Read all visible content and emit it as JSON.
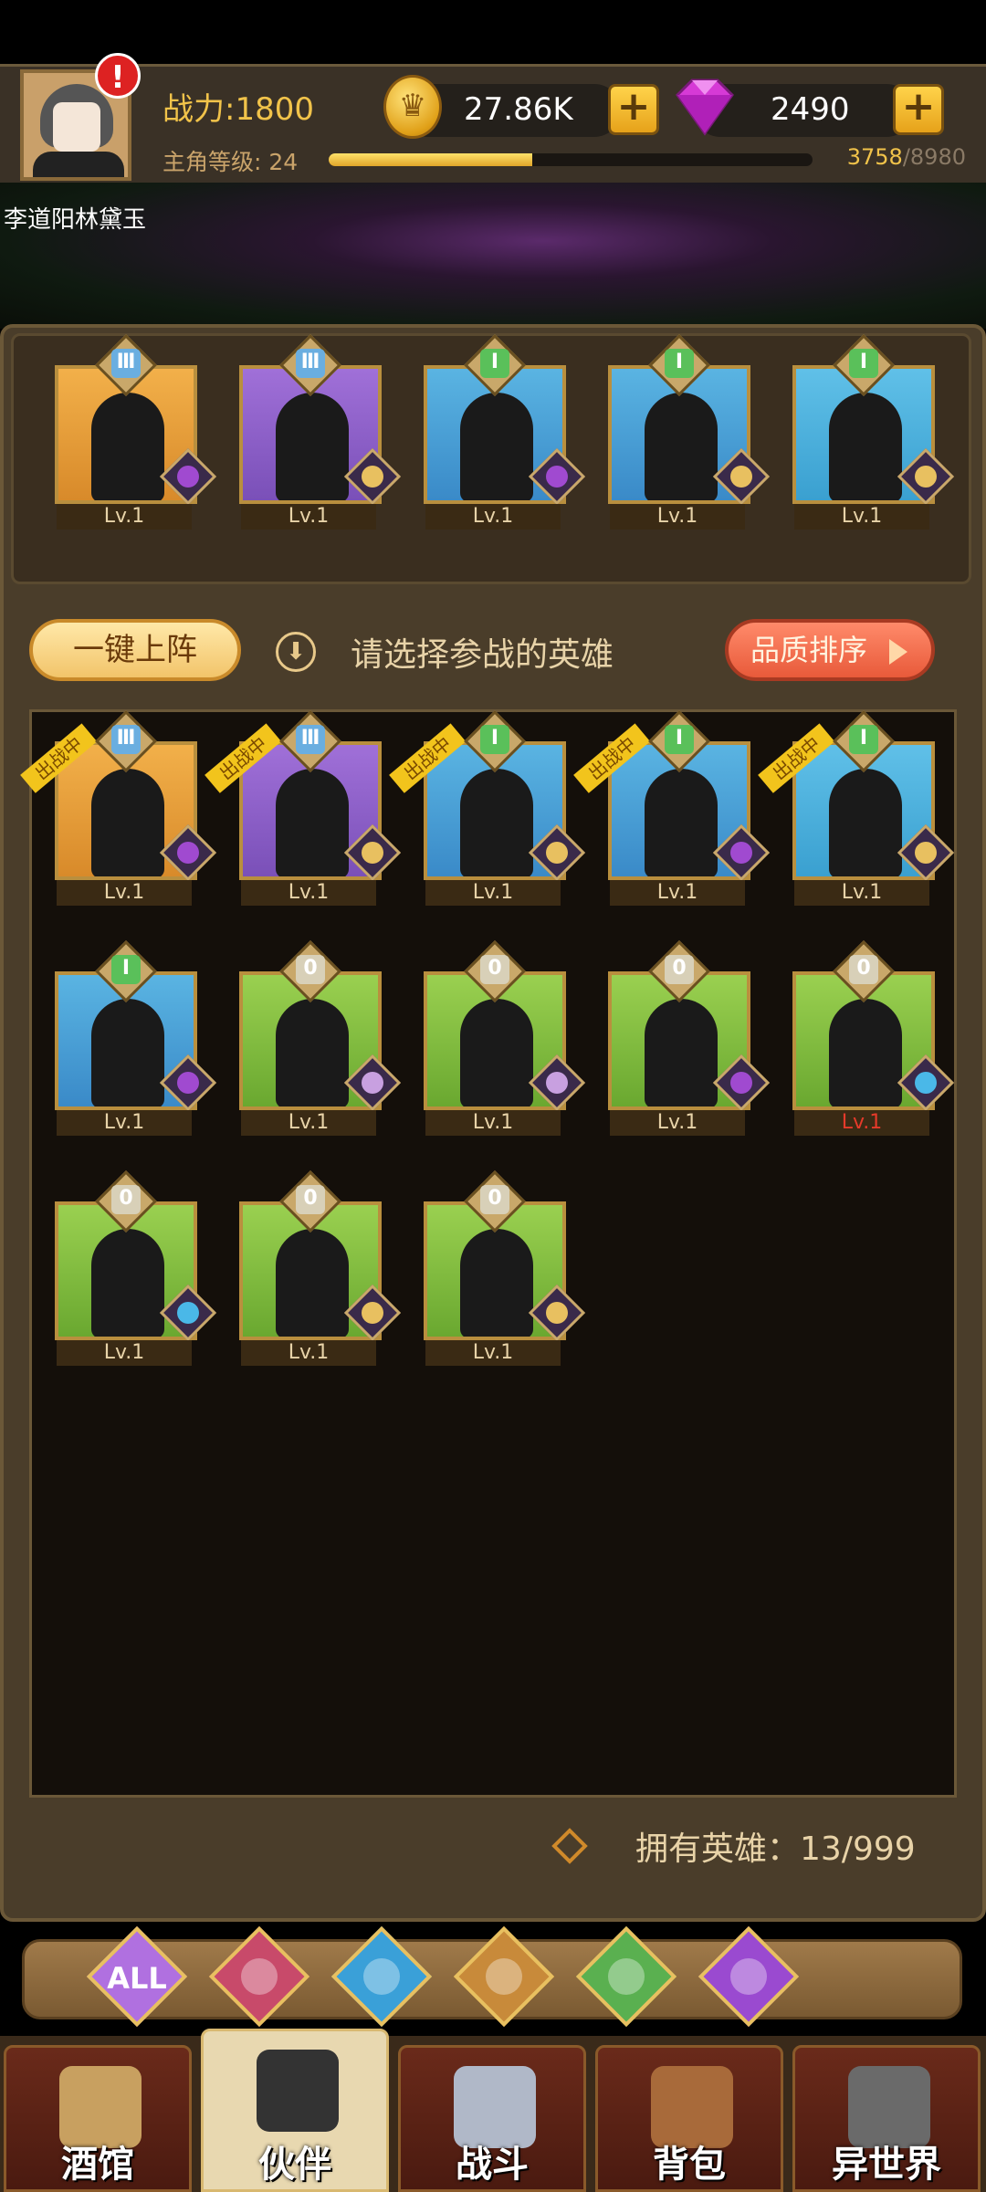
{
  "header": {
    "power_label": "战力:1800",
    "level_label": "主角等级: 24",
    "exp_current": "3758",
    "exp_max": "/8980",
    "exp_fraction": 0.42,
    "gold": "27.86K",
    "gems": "2490",
    "player_name": "李道阳林黛玉"
  },
  "team": [
    {
      "rank": "Ⅲ",
      "bg": "gold",
      "faction": "demon",
      "lv": "Lv.1"
    },
    {
      "rank": "Ⅲ",
      "bg": "purple",
      "faction": "elf",
      "lv": "Lv.1"
    },
    {
      "rank": "Ⅰ",
      "bg": "blue",
      "faction": "demon",
      "lv": "Lv.1"
    },
    {
      "rank": "Ⅰ",
      "bg": "blue",
      "faction": "elf",
      "lv": "Lv.1"
    },
    {
      "rank": "Ⅰ",
      "bg": "teal",
      "faction": "elf",
      "lv": "Lv.1"
    }
  ],
  "actions": {
    "onekey_label": "一键上阵",
    "prompt": "请选择参战的英雄",
    "sort_label": "品质排序"
  },
  "roster": [
    {
      "rank": "Ⅲ",
      "bg": "gold",
      "faction": "demon",
      "lv": "Lv.1",
      "deployed": "出战中"
    },
    {
      "rank": "Ⅲ",
      "bg": "purple",
      "faction": "elf",
      "lv": "Lv.1",
      "deployed": "出战中"
    },
    {
      "rank": "Ⅰ",
      "bg": "blue",
      "faction": "elf",
      "lv": "Lv.1",
      "deployed": "出战中"
    },
    {
      "rank": "Ⅰ",
      "bg": "blue",
      "faction": "demon",
      "lv": "Lv.1",
      "deployed": "出战中"
    },
    {
      "rank": "Ⅰ",
      "bg": "teal",
      "faction": "elf",
      "lv": "Lv.1",
      "deployed": "出战中"
    },
    {
      "rank": "Ⅰ",
      "bg": "blue",
      "faction": "demon",
      "lv": "Lv.1",
      "deployed": ""
    },
    {
      "rank": "0",
      "bg": "green",
      "faction": "human",
      "lv": "Lv.1",
      "deployed": ""
    },
    {
      "rank": "0",
      "bg": "green",
      "faction": "human",
      "lv": "Lv.1",
      "deployed": ""
    },
    {
      "rank": "0",
      "bg": "green",
      "faction": "demon",
      "lv": "Lv.1",
      "deployed": ""
    },
    {
      "rank": "0",
      "bg": "green",
      "faction": "sea",
      "lv": "Lv.1",
      "deployed": "",
      "red": true
    },
    {
      "rank": "0",
      "bg": "green",
      "faction": "sea",
      "lv": "Lv.1",
      "deployed": ""
    },
    {
      "rank": "0",
      "bg": "green",
      "faction": "elf",
      "lv": "Lv.1",
      "deployed": ""
    },
    {
      "rank": "0",
      "bg": "green",
      "faction": "elf",
      "lv": "Lv.1",
      "deployed": ""
    }
  ],
  "owned": "拥有英雄：13/999",
  "filters": [
    {
      "label": "ALL",
      "icon": "all-icon",
      "color": "#b070e0"
    },
    {
      "label": "",
      "icon": "human-faction-icon",
      "color": "#c84a6a"
    },
    {
      "label": "",
      "icon": "sea-faction-icon",
      "color": "#3aa0d8"
    },
    {
      "label": "",
      "icon": "beast-faction-icon",
      "color": "#c88a3a"
    },
    {
      "label": "",
      "icon": "elf-faction-icon",
      "color": "#5ab050"
    },
    {
      "label": "",
      "icon": "demon-faction-icon",
      "color": "#9a4ad0"
    }
  ],
  "nav": [
    {
      "label": "酒馆",
      "icon": "tavern-icon",
      "active": false
    },
    {
      "label": "伙伴",
      "icon": "partner-icon",
      "active": true
    },
    {
      "label": "战斗",
      "icon": "battle-icon",
      "active": false
    },
    {
      "label": "背包",
      "icon": "backpack-icon",
      "active": false
    },
    {
      "label": "异世界",
      "icon": "other-world-icon",
      "active": false
    }
  ]
}
